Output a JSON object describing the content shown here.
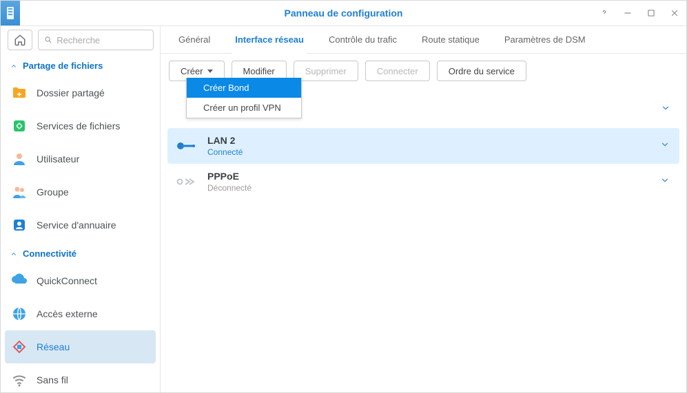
{
  "window": {
    "title": "Panneau de configuration"
  },
  "search": {
    "placeholder": "Recherche"
  },
  "sidebar": {
    "sections": [
      {
        "label": "Partage de fichiers",
        "items": [
          {
            "label": "Dossier partagé",
            "icon": "shared-folder-icon"
          },
          {
            "label": "Services de fichiers",
            "icon": "file-services-icon"
          },
          {
            "label": "Utilisateur",
            "icon": "user-icon"
          },
          {
            "label": "Groupe",
            "icon": "group-icon"
          },
          {
            "label": "Service d'annuaire",
            "icon": "directory-icon"
          }
        ]
      },
      {
        "label": "Connectivité",
        "items": [
          {
            "label": "QuickConnect",
            "icon": "quickconnect-icon"
          },
          {
            "label": "Accès externe",
            "icon": "external-access-icon"
          },
          {
            "label": "Réseau",
            "icon": "network-icon",
            "active": true
          },
          {
            "label": "Sans fil",
            "icon": "wireless-icon"
          }
        ]
      }
    ]
  },
  "tabs": [
    {
      "label": "Général"
    },
    {
      "label": "Interface réseau",
      "active": true
    },
    {
      "label": "Contrôle du trafic"
    },
    {
      "label": "Route statique"
    },
    {
      "label": "Paramètres de DSM"
    }
  ],
  "toolbar": {
    "create_label": "Créer",
    "edit_label": "Modifier",
    "delete_label": "Supprimer",
    "connect_label": "Connecter",
    "order_label": "Ordre du service"
  },
  "create_menu": {
    "items": [
      {
        "label": "Créer Bond",
        "hilite": true
      },
      {
        "label": "Créer un profil VPN"
      }
    ]
  },
  "interfaces": [
    {
      "name": "LAN 2",
      "status": "Connecté",
      "selected": true,
      "icon": "lan-connected-icon"
    },
    {
      "name": "PPPoE",
      "status": "Déconnecté",
      "selected": false,
      "icon": "pppoe-icon"
    }
  ],
  "colors": {
    "accent": "#1f7fd3",
    "selection": "#def0ff",
    "menu_hilite": "#0a89e6"
  }
}
